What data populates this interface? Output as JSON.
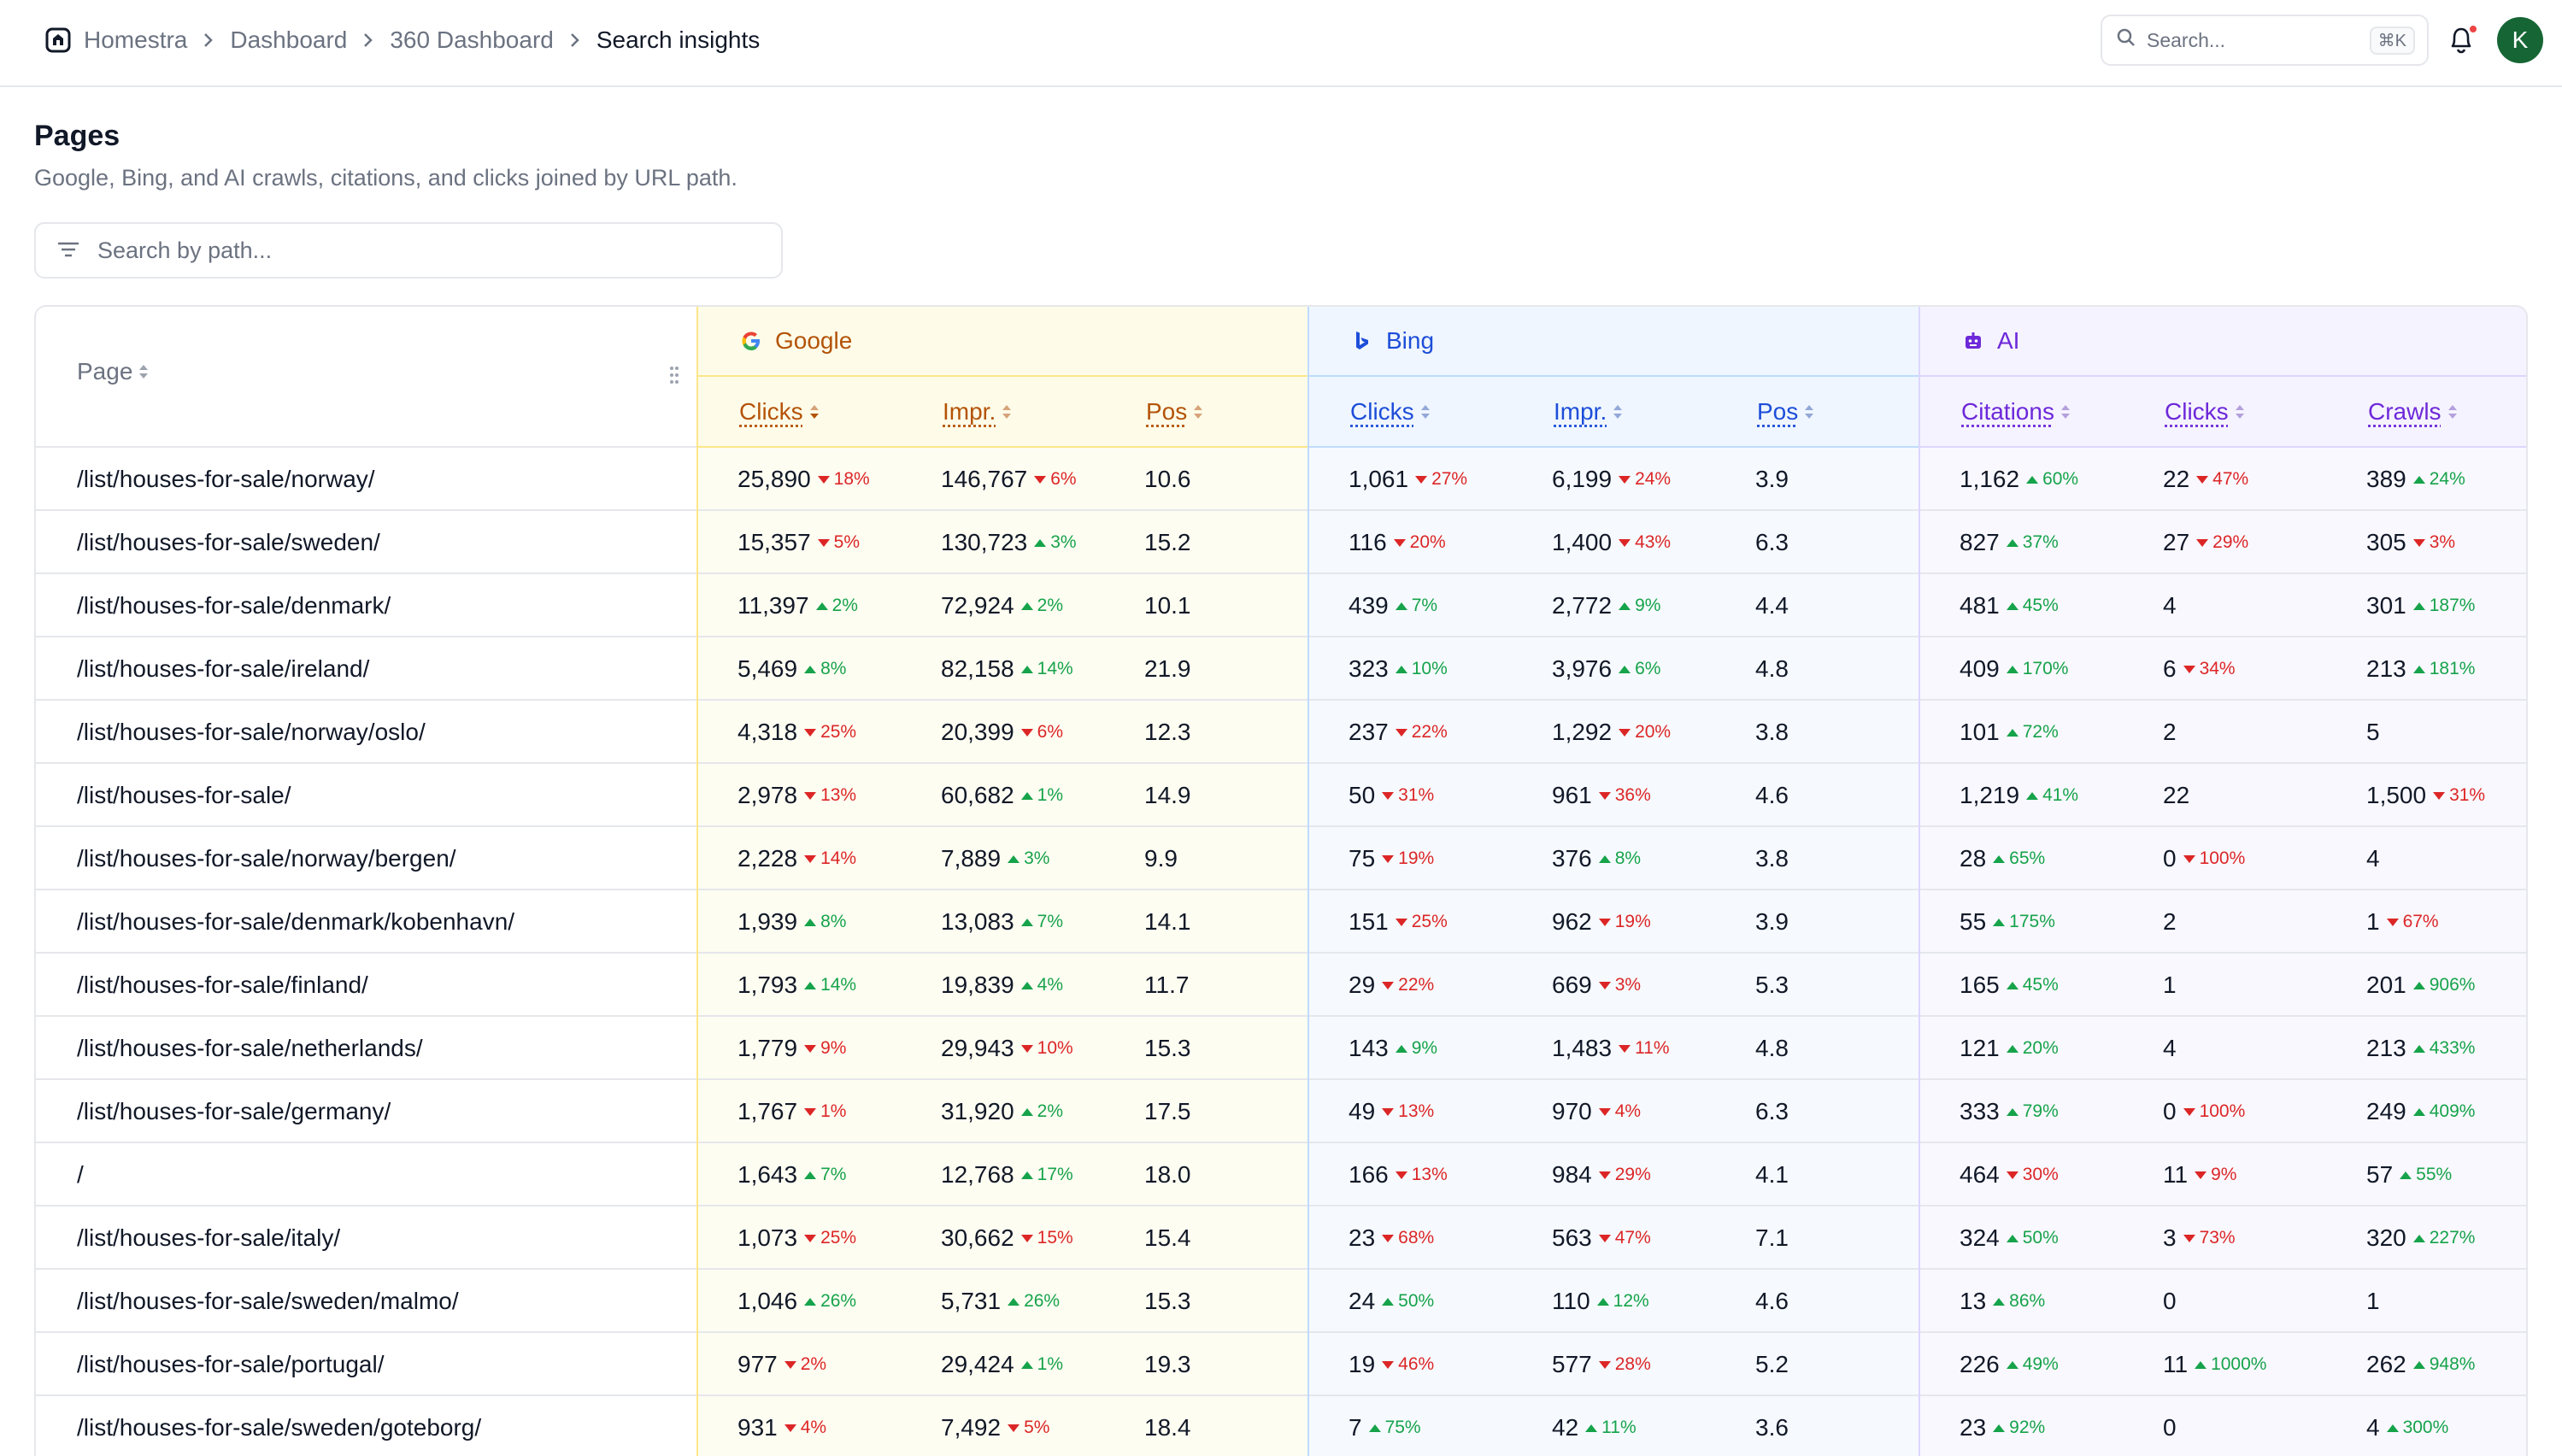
{
  "breadcrumb": [
    "Homestra",
    "Dashboard",
    "360 Dashboard",
    "Search insights"
  ],
  "top_search": {
    "placeholder": "Search...",
    "shortcut": "⌘K"
  },
  "user": {
    "initial": "K"
  },
  "page": {
    "title": "Pages",
    "subtitle": "Google, Bing, and AI crawls, citations, and clicks joined by URL path.",
    "search_placeholder": "Search by path..."
  },
  "table": {
    "page_header": "Page",
    "groups": [
      {
        "name": "Google",
        "columns": [
          "Clicks",
          "Impr.",
          "Pos"
        ]
      },
      {
        "name": "Bing",
        "columns": [
          "Clicks",
          "Impr.",
          "Pos"
        ]
      },
      {
        "name": "AI",
        "columns": [
          "Citations",
          "Clicks",
          "Crawls"
        ]
      }
    ],
    "rows": [
      {
        "path": "/list/houses-for-sale/norway/",
        "vals": [
          [
            "25,890",
            "down",
            "18%"
          ],
          [
            "146,767",
            "down",
            "6%"
          ],
          [
            "10.6"
          ],
          [
            "1,061",
            "down",
            "27%"
          ],
          [
            "6,199",
            "down",
            "24%"
          ],
          [
            "3.9"
          ],
          [
            "1,162",
            "up",
            "60%"
          ],
          [
            "22",
            "down",
            "47%"
          ],
          [
            "389",
            "up",
            "24%"
          ]
        ]
      },
      {
        "path": "/list/houses-for-sale/sweden/",
        "vals": [
          [
            "15,357",
            "down",
            "5%"
          ],
          [
            "130,723",
            "up",
            "3%"
          ],
          [
            "15.2"
          ],
          [
            "116",
            "down",
            "20%"
          ],
          [
            "1,400",
            "down",
            "43%"
          ],
          [
            "6.3"
          ],
          [
            "827",
            "up",
            "37%"
          ],
          [
            "27",
            "down",
            "29%"
          ],
          [
            "305",
            "down",
            "3%"
          ]
        ]
      },
      {
        "path": "/list/houses-for-sale/denmark/",
        "vals": [
          [
            "11,397",
            "up",
            "2%"
          ],
          [
            "72,924",
            "up",
            "2%"
          ],
          [
            "10.1"
          ],
          [
            "439",
            "up",
            "7%"
          ],
          [
            "2,772",
            "up",
            "9%"
          ],
          [
            "4.4"
          ],
          [
            "481",
            "up",
            "45%"
          ],
          [
            "4"
          ],
          [
            "301",
            "up",
            "187%"
          ]
        ]
      },
      {
        "path": "/list/houses-for-sale/ireland/",
        "vals": [
          [
            "5,469",
            "up",
            "8%"
          ],
          [
            "82,158",
            "up",
            "14%"
          ],
          [
            "21.9"
          ],
          [
            "323",
            "up",
            "10%"
          ],
          [
            "3,976",
            "up",
            "6%"
          ],
          [
            "4.8"
          ],
          [
            "409",
            "up",
            "170%"
          ],
          [
            "6",
            "down",
            "34%"
          ],
          [
            "213",
            "up",
            "181%"
          ]
        ]
      },
      {
        "path": "/list/houses-for-sale/norway/oslo/",
        "vals": [
          [
            "4,318",
            "down",
            "25%"
          ],
          [
            "20,399",
            "down",
            "6%"
          ],
          [
            "12.3"
          ],
          [
            "237",
            "down",
            "22%"
          ],
          [
            "1,292",
            "down",
            "20%"
          ],
          [
            "3.8"
          ],
          [
            "101",
            "up",
            "72%"
          ],
          [
            "2"
          ],
          [
            "5"
          ]
        ]
      },
      {
        "path": "/list/houses-for-sale/",
        "vals": [
          [
            "2,978",
            "down",
            "13%"
          ],
          [
            "60,682",
            "up",
            "1%"
          ],
          [
            "14.9"
          ],
          [
            "50",
            "down",
            "31%"
          ],
          [
            "961",
            "down",
            "36%"
          ],
          [
            "4.6"
          ],
          [
            "1,219",
            "up",
            "41%"
          ],
          [
            "22"
          ],
          [
            "1,500",
            "down",
            "31%"
          ]
        ]
      },
      {
        "path": "/list/houses-for-sale/norway/bergen/",
        "vals": [
          [
            "2,228",
            "down",
            "14%"
          ],
          [
            "7,889",
            "up",
            "3%"
          ],
          [
            "9.9"
          ],
          [
            "75",
            "down",
            "19%"
          ],
          [
            "376",
            "up",
            "8%"
          ],
          [
            "3.8"
          ],
          [
            "28",
            "up",
            "65%"
          ],
          [
            "0",
            "down",
            "100%"
          ],
          [
            "4"
          ]
        ]
      },
      {
        "path": "/list/houses-for-sale/denmark/kobenhavn/",
        "vals": [
          [
            "1,939",
            "up",
            "8%"
          ],
          [
            "13,083",
            "up",
            "7%"
          ],
          [
            "14.1"
          ],
          [
            "151",
            "down",
            "25%"
          ],
          [
            "962",
            "down",
            "19%"
          ],
          [
            "3.9"
          ],
          [
            "55",
            "up",
            "175%"
          ],
          [
            "2"
          ],
          [
            "1",
            "down",
            "67%"
          ]
        ]
      },
      {
        "path": "/list/houses-for-sale/finland/",
        "vals": [
          [
            "1,793",
            "up",
            "14%"
          ],
          [
            "19,839",
            "up",
            "4%"
          ],
          [
            "11.7"
          ],
          [
            "29",
            "down",
            "22%"
          ],
          [
            "669",
            "down",
            "3%"
          ],
          [
            "5.3"
          ],
          [
            "165",
            "up",
            "45%"
          ],
          [
            "1"
          ],
          [
            "201",
            "up",
            "906%"
          ]
        ]
      },
      {
        "path": "/list/houses-for-sale/netherlands/",
        "vals": [
          [
            "1,779",
            "down",
            "9%"
          ],
          [
            "29,943",
            "down",
            "10%"
          ],
          [
            "15.3"
          ],
          [
            "143",
            "up",
            "9%"
          ],
          [
            "1,483",
            "down",
            "11%"
          ],
          [
            "4.8"
          ],
          [
            "121",
            "up",
            "20%"
          ],
          [
            "4"
          ],
          [
            "213",
            "up",
            "433%"
          ]
        ]
      },
      {
        "path": "/list/houses-for-sale/germany/",
        "vals": [
          [
            "1,767",
            "down",
            "1%"
          ],
          [
            "31,920",
            "up",
            "2%"
          ],
          [
            "17.5"
          ],
          [
            "49",
            "down",
            "13%"
          ],
          [
            "970",
            "down",
            "4%"
          ],
          [
            "6.3"
          ],
          [
            "333",
            "up",
            "79%"
          ],
          [
            "0",
            "down",
            "100%"
          ],
          [
            "249",
            "up",
            "409%"
          ]
        ]
      },
      {
        "path": "/",
        "vals": [
          [
            "1,643",
            "up",
            "7%"
          ],
          [
            "12,768",
            "up",
            "17%"
          ],
          [
            "18.0"
          ],
          [
            "166",
            "down",
            "13%"
          ],
          [
            "984",
            "down",
            "29%"
          ],
          [
            "4.1"
          ],
          [
            "464",
            "down",
            "30%"
          ],
          [
            "11",
            "down",
            "9%"
          ],
          [
            "57",
            "up",
            "55%"
          ]
        ]
      },
      {
        "path": "/list/houses-for-sale/italy/",
        "vals": [
          [
            "1,073",
            "down",
            "25%"
          ],
          [
            "30,662",
            "down",
            "15%"
          ],
          [
            "15.4"
          ],
          [
            "23",
            "down",
            "68%"
          ],
          [
            "563",
            "down",
            "47%"
          ],
          [
            "7.1"
          ],
          [
            "324",
            "up",
            "50%"
          ],
          [
            "3",
            "down",
            "73%"
          ],
          [
            "320",
            "up",
            "227%"
          ]
        ]
      },
      {
        "path": "/list/houses-for-sale/sweden/malmo/",
        "vals": [
          [
            "1,046",
            "up",
            "26%"
          ],
          [
            "5,731",
            "up",
            "26%"
          ],
          [
            "15.3"
          ],
          [
            "24",
            "up",
            "50%"
          ],
          [
            "110",
            "up",
            "12%"
          ],
          [
            "4.6"
          ],
          [
            "13",
            "up",
            "86%"
          ],
          [
            "0"
          ],
          [
            "1"
          ]
        ]
      },
      {
        "path": "/list/houses-for-sale/portugal/",
        "vals": [
          [
            "977",
            "down",
            "2%"
          ],
          [
            "29,424",
            "up",
            "1%"
          ],
          [
            "19.3"
          ],
          [
            "19",
            "down",
            "46%"
          ],
          [
            "577",
            "down",
            "28%"
          ],
          [
            "5.2"
          ],
          [
            "226",
            "up",
            "49%"
          ],
          [
            "11",
            "up",
            "1000%"
          ],
          [
            "262",
            "up",
            "948%"
          ]
        ]
      },
      {
        "path": "/list/houses-for-sale/sweden/goteborg/",
        "vals": [
          [
            "931",
            "down",
            "4%"
          ],
          [
            "7,492",
            "down",
            "5%"
          ],
          [
            "18.4"
          ],
          [
            "7",
            "up",
            "75%"
          ],
          [
            "42",
            "up",
            "11%"
          ],
          [
            "3.6"
          ],
          [
            "23",
            "up",
            "92%"
          ],
          [
            "0"
          ],
          [
            "4",
            "up",
            "300%"
          ]
        ]
      }
    ]
  },
  "colors": {
    "google_bg": "#fefce8",
    "bing_bg": "#eff6ff",
    "ai_bg": "#f5f3ff",
    "up": "#16a34a",
    "down": "#dc2626"
  }
}
